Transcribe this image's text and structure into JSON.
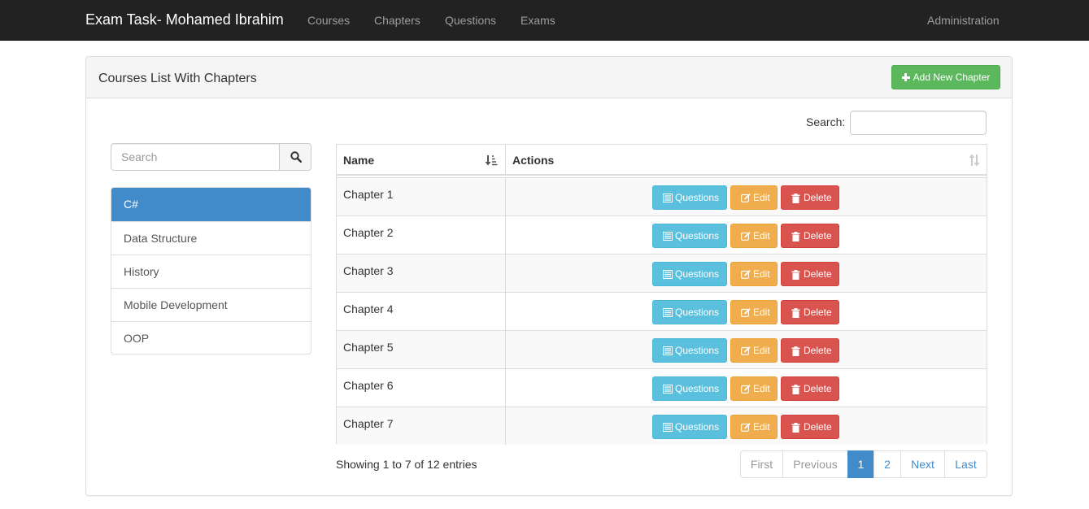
{
  "navbar": {
    "brand": "Exam Task- Mohamed Ibrahim",
    "links": [
      "Courses",
      "Chapters",
      "Questions",
      "Exams"
    ],
    "right_link": "Administration"
  },
  "panel": {
    "title": "Courses List With Chapters",
    "add_button_label": "Add New Chapter"
  },
  "course_search": {
    "placeholder": "Search",
    "button_icon": "search-icon"
  },
  "courses": {
    "items": [
      "C#",
      "Data Structure",
      "History",
      "Mobile Development",
      "OOP"
    ],
    "selected": "C#"
  },
  "table": {
    "search_label": "Search:",
    "search_value": "",
    "columns": [
      "Name",
      "Actions"
    ],
    "sort": {
      "column": "Name",
      "direction": "ascending"
    },
    "rows": [
      {
        "name": "Chapter 1"
      },
      {
        "name": "Chapter 2"
      },
      {
        "name": "Chapter 3"
      },
      {
        "name": "Chapter 4"
      },
      {
        "name": "Chapter 5"
      },
      {
        "name": "Chapter 6"
      },
      {
        "name": "Chapter 7"
      }
    ],
    "action_labels": {
      "questions": "Questions",
      "edit": "Edit",
      "delete": "Delete"
    },
    "action_icons": {
      "questions": "list-icon",
      "edit": "edit-icon",
      "delete": "trash-icon"
    },
    "info": "Showing 1 to 7 of 12 entries"
  },
  "pagination": {
    "first": "First",
    "previous": "Previous",
    "pages": [
      "1",
      "2"
    ],
    "current_page": "1",
    "next": "Next",
    "last": "Last"
  },
  "colors": {
    "navbar_bg": "#222222",
    "primary": "#428bca",
    "success": "#5cb85c",
    "info": "#5bc0de",
    "warning": "#f0ad4e",
    "danger": "#d9534f"
  }
}
